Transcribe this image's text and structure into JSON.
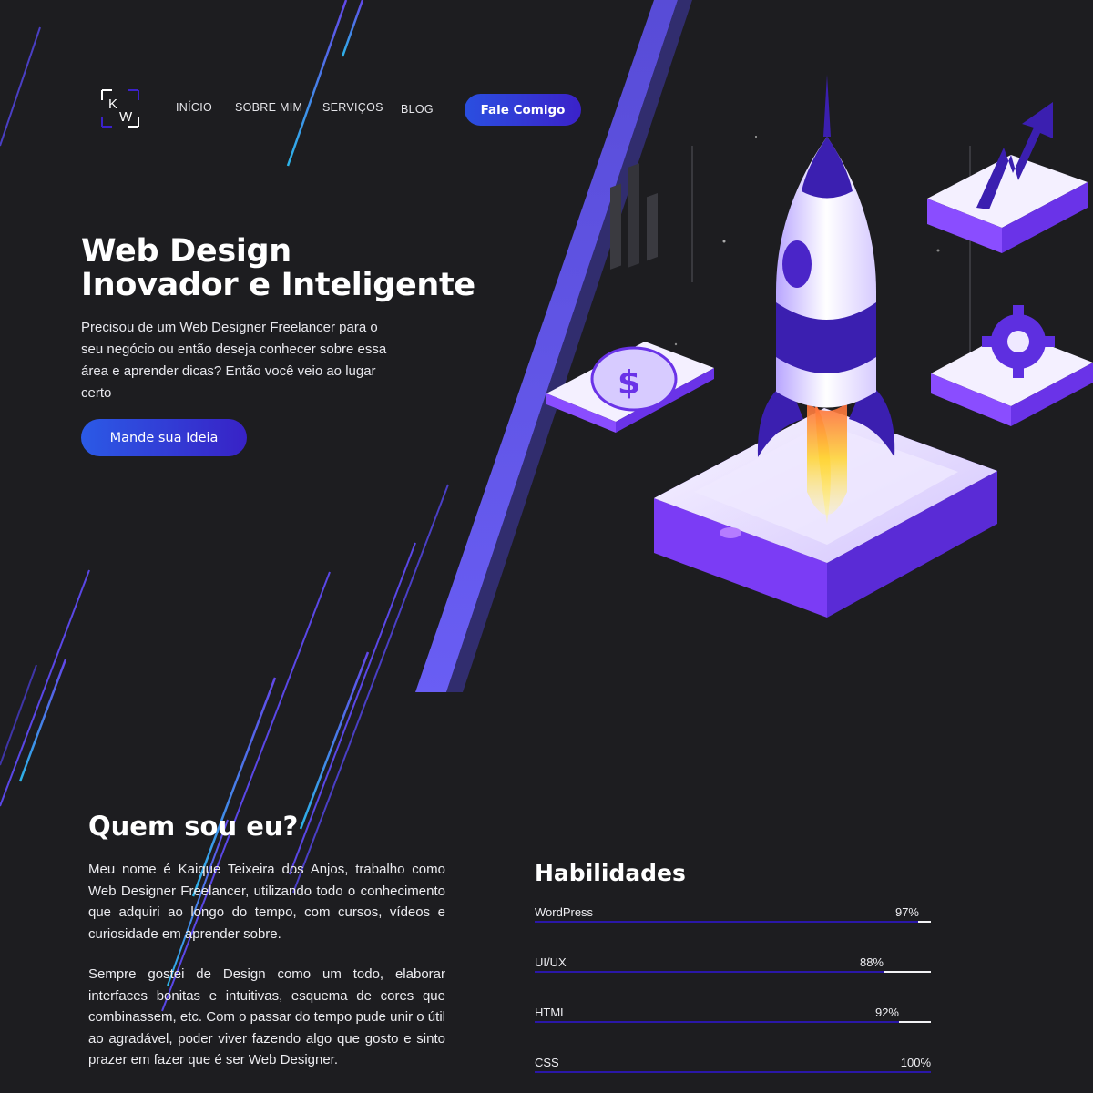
{
  "header": {
    "logo_text": "KW",
    "nav": [
      {
        "label": "INÍCIO"
      },
      {
        "label": "SOBRE MIM"
      },
      {
        "label": "SERVIÇOS"
      },
      {
        "label": "BLOG"
      }
    ],
    "cta_label": "Fale Comigo"
  },
  "hero": {
    "title_line1": "Web Design",
    "title_line2": "Inovador e Inteligente",
    "text": "Precisou de um Web Designer Freelancer para o seu negócio ou então deseja conhecer sobre essa área e aprender dicas? Então você veio ao lugar certo",
    "cta_label": "Mande sua Ideia"
  },
  "about": {
    "title": "Quem sou eu?",
    "paragraph1": "Meu nome é Kaique Teixeira dos Anjos, trabalho como Web Designer Freelancer, utilizando todo o conhecimento que adquiri ao longo do tempo, com cursos, vídeos e curiosidade em aprender sobre.",
    "paragraph2": "Sempre gostei de Design como um todo, elaborar interfaces bonitas e intuitivas, esquema de cores que combinassem, etc. Com o passar do tempo pude unir o útil ao agradável, poder viver fazendo algo que gosto e sinto prazer em fazer que é ser Web Designer."
  },
  "skills": {
    "title": "Habilidades",
    "items": [
      {
        "name": "WordPress",
        "value_label": "97%",
        "level": 97
      },
      {
        "name": "UI/UX",
        "value_label": "88%",
        "level": 88
      },
      {
        "name": "HTML",
        "value_label": "92%",
        "level": 92
      },
      {
        "name": "CSS",
        "value_label": "100%",
        "level": 100
      }
    ]
  },
  "colors": {
    "background": "#1d1d20",
    "accent_blue": "#2b5ae6",
    "accent_purple": "#3822c6",
    "bar_track": "#2a17a8"
  },
  "icons": {
    "hero_illustration": "rocket-launch-illustration"
  }
}
